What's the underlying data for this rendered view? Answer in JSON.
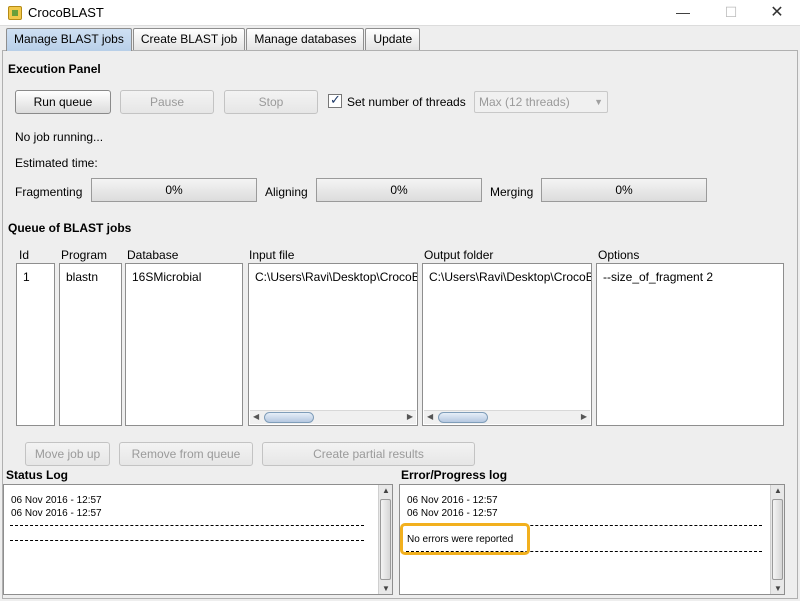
{
  "window": {
    "title": "CrocoBLAST",
    "min": "—",
    "max": "☐",
    "close": "✕"
  },
  "tabs": [
    {
      "label": "Manage BLAST jobs",
      "active": true
    },
    {
      "label": "Create BLAST job"
    },
    {
      "label": "Manage databases"
    },
    {
      "label": "Update"
    }
  ],
  "execution": {
    "heading": "Execution Panel",
    "run_label": "Run queue",
    "pause_label": "Pause",
    "stop_label": "Stop",
    "threads_label": "Set number of threads",
    "threads_checked": true,
    "threads_value": "Max (12 threads)",
    "status": "No job running...",
    "estimated": "Estimated time:",
    "fragmenting_label": "Fragmenting",
    "fragmenting_value": "0%",
    "aligning_label": "Aligning",
    "aligning_value": "0%",
    "merging_label": "Merging",
    "merging_value": "0%"
  },
  "queue": {
    "heading": "Queue of BLAST jobs",
    "headers": [
      "Id",
      "Program",
      "Database",
      "Input file",
      "Output folder",
      "Options"
    ],
    "row": {
      "id": "1",
      "program": "blastn",
      "database": "16SMicrobial",
      "input": "C:\\Users\\Ravi\\Desktop\\CrocoBLA",
      "output": "C:\\Users\\Ravi\\Desktop\\CrocoBLA",
      "options": "--size_of_fragment 2"
    },
    "move_label": "Move job up",
    "remove_label": "Remove from queue",
    "partial_label": "Create partial results"
  },
  "status_log": {
    "heading": "Status Log",
    "line1": "06 Nov 2016 - 12:57",
    "line2": "06 Nov 2016 - 12:57"
  },
  "error_log": {
    "heading": "Error/Progress log",
    "line1": "06 Nov 2016 - 12:57",
    "line2": "06 Nov 2016 - 12:57",
    "message": "No errors were reported",
    "highlight_color": "#f2b01e"
  }
}
